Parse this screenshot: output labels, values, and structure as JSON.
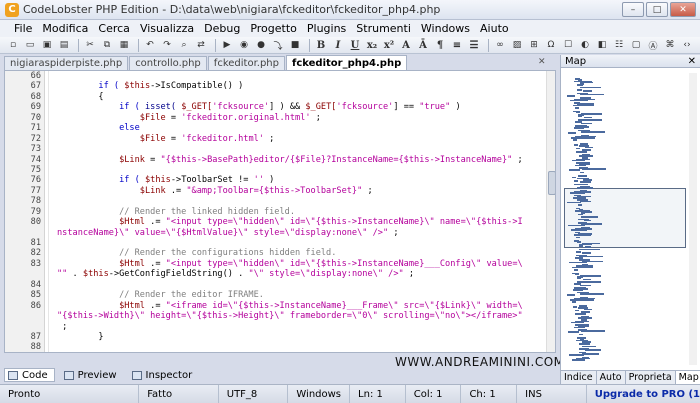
{
  "window": {
    "title": "CodeLobster PHP Edition - D:\\data\\web\\nigiara\\fckeditor\\fckeditor_php4.php"
  },
  "menu": [
    "File",
    "Modifica",
    "Cerca",
    "Visualizza",
    "Debug",
    "Progetto",
    "Plugins",
    "Strumenti",
    "Windows",
    "Aiuto"
  ],
  "toolbar": {
    "tools": [
      "new-file-icon",
      "open-folder-icon",
      "save-icon",
      "save-all-icon",
      "cut-icon",
      "copy-icon",
      "paste-icon",
      "undo-icon",
      "redo-icon",
      "find-icon",
      "find-replace-icon",
      "run-icon",
      "debug-icon",
      "breakpoint-icon",
      "step-icon",
      "stop-icon"
    ],
    "formatting": [
      "B",
      "I",
      "U",
      "x₂",
      "x²",
      "A",
      "Ā",
      "¶",
      "≡",
      "☰"
    ],
    "extra": [
      "link-icon",
      "image-icon",
      "table-icon",
      "special-char-icon",
      "form-icon",
      "color-icon",
      "highlight-icon",
      "list-icon",
      "frame-icon",
      "text-color-icon",
      "php-icon",
      "tag-icon"
    ]
  },
  "tabs": [
    "nigiaraspiderpiste.php",
    "controllo.php",
    "fckeditor.php",
    "fckeditor_php4.php"
  ],
  "active_tab": 3,
  "editor": {
    "lines": [
      {
        "n": "66",
        "t": []
      },
      {
        "n": "67",
        "t": [
          [
            "        if ( ",
            "kw"
          ],
          [
            "$this",
            "var"
          ],
          [
            "->IsCompatible() )",
            ""
          ]
        ]
      },
      {
        "n": "68",
        "t": [
          [
            "        {",
            ""
          ]
        ]
      },
      {
        "n": "69",
        "t": [
          [
            "            if ( ",
            "kw"
          ],
          [
            "isset(",
            "fn"
          ],
          [
            " $_GET[",
            "var"
          ],
          [
            "'fcksource'",
            "str"
          ],
          [
            "] ) && ",
            ""
          ],
          [
            "$_GET[",
            "var"
          ],
          [
            "'fcksource'",
            "str"
          ],
          [
            "] == ",
            ""
          ],
          [
            "\"true\"",
            "str"
          ],
          [
            " )",
            ""
          ]
        ]
      },
      {
        "n": "70",
        "t": [
          [
            "                $File",
            "var"
          ],
          [
            " = ",
            ""
          ],
          [
            "'fckeditor.original.html'",
            "str"
          ],
          [
            " ;",
            ""
          ]
        ]
      },
      {
        "n": "71",
        "t": [
          [
            "            else",
            "kw"
          ]
        ]
      },
      {
        "n": "72",
        "t": [
          [
            "                $File",
            "var"
          ],
          [
            " = ",
            ""
          ],
          [
            "'fckeditor.html'",
            "str"
          ],
          [
            " ;",
            ""
          ]
        ]
      },
      {
        "n": "73",
        "t": []
      },
      {
        "n": "74",
        "t": [
          [
            "            $Link",
            "var"
          ],
          [
            " = ",
            ""
          ],
          [
            "\"{$this->BasePath}editor/{$File}?InstanceName={$this->InstanceName}\"",
            "str"
          ],
          [
            " ;",
            ""
          ]
        ]
      },
      {
        "n": "75",
        "t": []
      },
      {
        "n": "76",
        "t": [
          [
            "            if ( ",
            "kw"
          ],
          [
            "$this",
            "var"
          ],
          [
            "->ToolbarSet != ",
            ""
          ],
          [
            "''",
            "str"
          ],
          [
            " )",
            ""
          ]
        ]
      },
      {
        "n": "77",
        "t": [
          [
            "                $Link",
            "var"
          ],
          [
            " .= ",
            ""
          ],
          [
            "\"&amp;Toolbar={$this->ToolbarSet}\"",
            "str"
          ],
          [
            " ;",
            ""
          ]
        ]
      },
      {
        "n": "78",
        "t": []
      },
      {
        "n": "79",
        "t": [
          [
            "            // Render the linked hidden field.",
            "com"
          ]
        ]
      },
      {
        "n": "80",
        "t": [
          [
            "            $Html",
            "var"
          ],
          [
            " .= ",
            ""
          ],
          [
            "\"<input type=\\\"hidden\\\" id=\\\"{$this->InstanceName}\\\" name=\\\"{$this->I",
            "str"
          ]
        ]
      },
      {
        "n": "",
        "t": [
          [
            "nstanceName}\\\" value=\\\"{$HtmlValue}\\\" style=\\\"display:none\\\" />\"",
            "str"
          ],
          [
            " ;",
            ""
          ]
        ]
      },
      {
        "n": "81",
        "t": []
      },
      {
        "n": "82",
        "t": [
          [
            "            // Render the configurations hidden field.",
            "com"
          ]
        ]
      },
      {
        "n": "83",
        "t": [
          [
            "            $Html",
            "var"
          ],
          [
            " .= ",
            ""
          ],
          [
            "\"<input type=\\\"hidden\\\" id=\\\"{$this->InstanceName}___Config\\\" value=\\",
            "str"
          ]
        ]
      },
      {
        "n": "",
        "t": [
          [
            "\"\"",
            "str"
          ],
          [
            " . ",
            ""
          ],
          [
            "$this",
            "var"
          ],
          [
            "->GetConfigFieldString() . ",
            ""
          ],
          [
            "\"\\\" style=\\\"display:none\\\" />\"",
            "str"
          ],
          [
            " ;",
            ""
          ]
        ]
      },
      {
        "n": "84",
        "t": []
      },
      {
        "n": "85",
        "t": [
          [
            "            // Render the editor IFRAME.",
            "com"
          ]
        ]
      },
      {
        "n": "86",
        "t": [
          [
            "            $Html",
            "var"
          ],
          [
            " .= ",
            ""
          ],
          [
            "\"<iframe id=\\\"{$this->InstanceName}___Frame\\\" src=\\\"{$Link}\\\" width=\\",
            "str"
          ]
        ]
      },
      {
        "n": "",
        "t": [
          [
            "\"{$this->Width}\\\" height=\\\"{$this->Height}\\\" frameborder=\\\"0\\\" scrolling=\\\"no\\\"></iframe>\"",
            "str"
          ]
        ]
      },
      {
        "n": "",
        "t": [
          [
            " ;",
            ""
          ]
        ]
      },
      {
        "n": "87",
        "t": [
          [
            "        }",
            ""
          ]
        ]
      },
      {
        "n": "88",
        "t": []
      }
    ]
  },
  "watermark": "WWW.ANDREAMININI.COM",
  "bottom_tabs": [
    "Code",
    "Preview",
    "Inspector"
  ],
  "status": {
    "state": "Pronto",
    "done": "Fatto",
    "encoding": "UTF_8",
    "os": "Windows",
    "line": "Ln: 1",
    "col": "Col: 1",
    "ch": "Ch: 1",
    "ins": "INS",
    "upgrade": "Upgrade to PRO (1"
  },
  "panel": {
    "title": "Map",
    "tabs": [
      "Indice",
      "Auto",
      "Proprieta",
      "Map"
    ]
  }
}
